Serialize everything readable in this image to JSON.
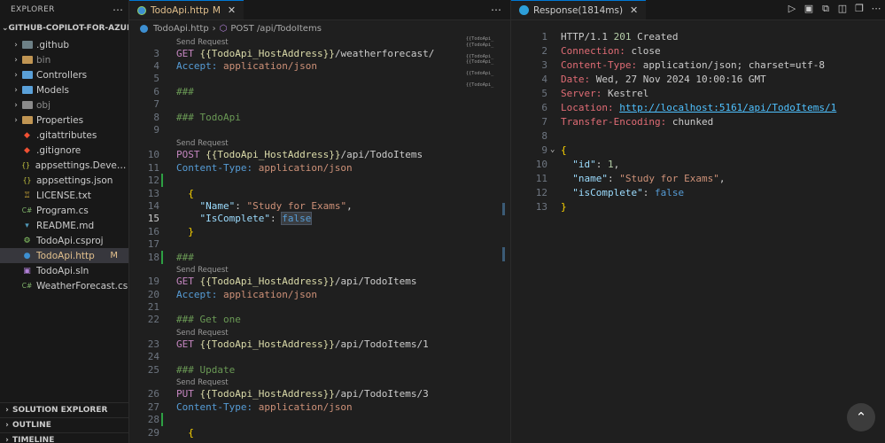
{
  "explorer": {
    "title": "EXPLORER",
    "root_label": "GITHUB-COPILOT-FOR-AZURE-...",
    "items": [
      {
        "label": ".github",
        "kind": "folder",
        "icon": "github-folder-icon"
      },
      {
        "label": "bin",
        "kind": "folder",
        "icon": "bin-folder-icon"
      },
      {
        "label": "Controllers",
        "kind": "folder",
        "icon": "controllers-folder-icon"
      },
      {
        "label": "Models",
        "kind": "folder",
        "icon": "models-folder-icon"
      },
      {
        "label": "obj",
        "kind": "folder",
        "icon": "obj-folder-icon"
      },
      {
        "label": "Properties",
        "kind": "folder",
        "icon": "properties-folder-icon"
      },
      {
        "label": ".gitattributes",
        "kind": "file",
        "icon": "git-icon"
      },
      {
        "label": ".gitignore",
        "kind": "file",
        "icon": "git-icon"
      },
      {
        "label": "appsettings.Develop...",
        "kind": "file",
        "icon": "json-icon"
      },
      {
        "label": "appsettings.json",
        "kind": "file",
        "icon": "json-icon"
      },
      {
        "label": "LICENSE.txt",
        "kind": "file",
        "icon": "license-icon"
      },
      {
        "label": "Program.cs",
        "kind": "file",
        "icon": "csharp-icon"
      },
      {
        "label": "README.md",
        "kind": "file",
        "icon": "markdown-icon"
      },
      {
        "label": "TodoApi.csproj",
        "kind": "file",
        "icon": "csproj-icon"
      },
      {
        "label": "TodoApi.http",
        "kind": "file",
        "icon": "http-icon",
        "badge": "M"
      },
      {
        "label": "TodoApi.sln",
        "kind": "file",
        "icon": "sln-icon"
      },
      {
        "label": "WeatherForecast.cs",
        "kind": "file",
        "icon": "csharp-icon"
      }
    ],
    "sections": [
      "SOLUTION EXPLORER",
      "OUTLINE",
      "TIMELINE"
    ]
  },
  "editor": {
    "tab_label": "TodoApi.http",
    "tab_modified": "M",
    "breadcrumb_file": "TodoApi.http",
    "breadcrumb_symbol": "POST /api/TodoItems",
    "codelens": "Send Request",
    "line_numbers": [
      "3",
      "4",
      "5",
      "6",
      "7",
      "8",
      "9",
      "10",
      "11",
      "12",
      "13",
      "14",
      "15",
      "16",
      "17",
      "18",
      "19",
      "20",
      "21",
      "22",
      "23",
      "24",
      "25",
      "26",
      "27",
      "28",
      "29"
    ],
    "lines": {
      "l3_method": "GET",
      "l3_var": "{{TodoApi_HostAddress}}",
      "l3_path": "/weatherforecast/",
      "l4_key": "Accept:",
      "l4_val": "application/json",
      "l6": "###",
      "l8": "### TodoApi",
      "l10_method": "POST",
      "l10_var": "{{TodoApi_HostAddress}}",
      "l10_path": "/api/TodoItems",
      "l11_key": "Content-Type:",
      "l11_val": "application/json",
      "l13": "{",
      "l14_key": "\"Name\"",
      "l14_val": "\"Study for Exams\"",
      "l15_key": "\"IsComplete\"",
      "l15_val": "false",
      "l16": "}",
      "l18": "###",
      "l19_method": "GET",
      "l19_var": "{{TodoApi_HostAddress}}",
      "l19_path": "/api/TodoItems",
      "l20_key": "Accept:",
      "l20_val": "application/json",
      "l22": "### Get one",
      "l23_method": "GET",
      "l23_var": "{{TodoApi_HostAddress}}",
      "l23_path": "/api/TodoItems/1",
      "l25": "### Update",
      "l26_method": "PUT",
      "l26_var": "{{TodoApi_HostAddress}}",
      "l26_path": "/api/TodoItems/3",
      "l27_key": "Content-Type:",
      "l27_val": "application/json",
      "l29": "{"
    },
    "minimap": "{{TodoApi_\n{{TodoApi_\n\n{{TodoApi_\n{{TodoApi_\n\n{{TodoApi_\n\n{{TodoApi_"
  },
  "response": {
    "tab_label": "Response(1814ms)",
    "line_numbers": [
      "1",
      "2",
      "3",
      "4",
      "5",
      "6",
      "7",
      "8",
      "9",
      "10",
      "11",
      "12",
      "13"
    ],
    "status_proto": "HTTP/1.1",
    "status_code": "201",
    "status_text": "Created",
    "headers": [
      {
        "name": "Connection:",
        "value": "close"
      },
      {
        "name": "Content-Type:",
        "value": "application/json; charset=utf-8"
      },
      {
        "name": "Date:",
        "value": "Wed, 27 Nov 2024 10:00:16 GMT"
      },
      {
        "name": "Server:",
        "value": "Kestrel"
      },
      {
        "name": "Location:",
        "value": "http://localhost:5161/api/TodoItems/1"
      },
      {
        "name": "Transfer-Encoding:",
        "value": "chunked"
      }
    ],
    "body": {
      "open": "{",
      "id_key": "\"id\"",
      "id_val": "1",
      "name_key": "\"name\"",
      "name_val": "\"Study for Exams\"",
      "complete_key": "\"isComplete\"",
      "complete_val": "false",
      "close": "}"
    }
  }
}
